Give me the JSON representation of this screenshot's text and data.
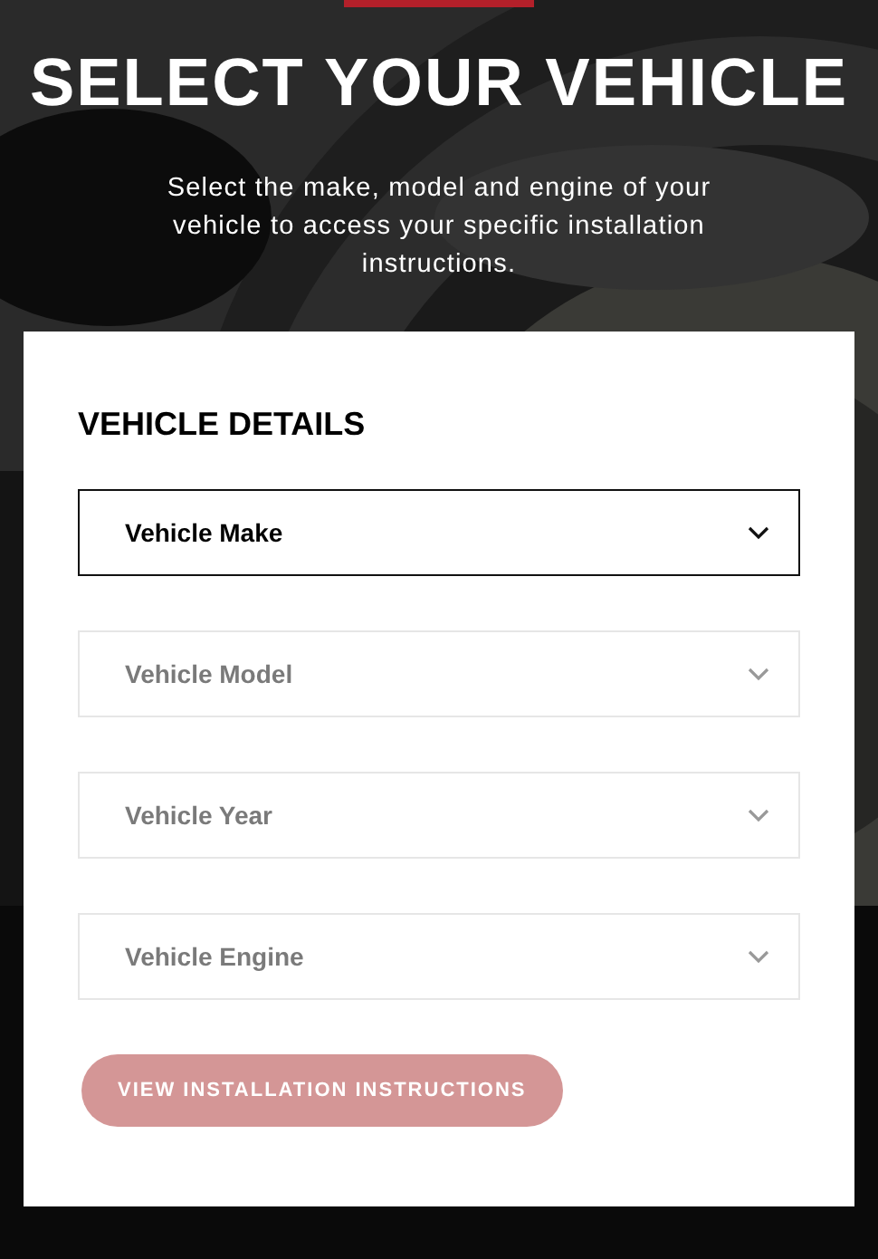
{
  "header": {
    "title": "SELECT YOUR VEHICLE",
    "subtitle": "Select the make, model and engine of your vehicle to access your specific installation instructions."
  },
  "card": {
    "heading": "VEHICLE DETAILS",
    "dropdowns": [
      {
        "label": "Vehicle Make",
        "disabled": false
      },
      {
        "label": "Vehicle Model",
        "disabled": true
      },
      {
        "label": "Vehicle Year",
        "disabled": true
      },
      {
        "label": "Vehicle Engine",
        "disabled": true
      }
    ],
    "button": {
      "label": "VIEW INSTALLATION INSTRUCTIONS",
      "disabled": true
    }
  }
}
